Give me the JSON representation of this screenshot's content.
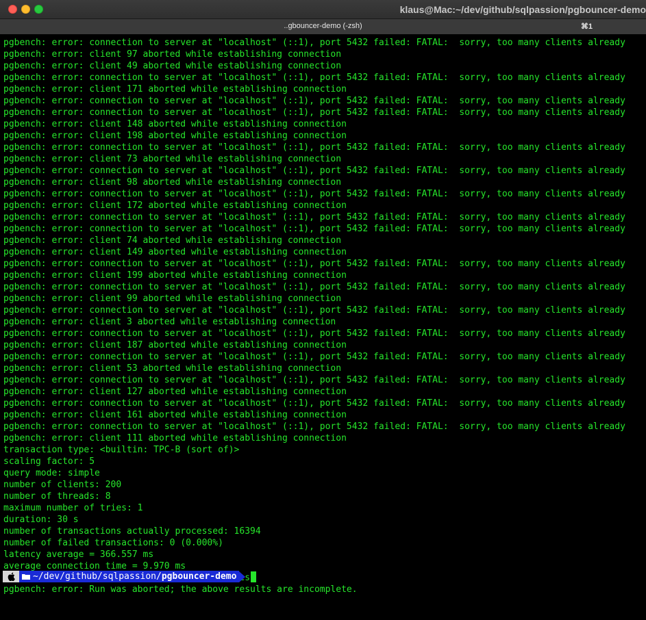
{
  "window": {
    "title": "klaus@Mac:~/dev/github/sqlpassion/pgbouncer-demo",
    "tab_label": "..gbouncer-demo (-zsh)",
    "tab_shortcut": "⌘1"
  },
  "terminal": {
    "lines": [
      "pgbench: error: connection to server at \"localhost\" (::1), port 5432 failed: FATAL:  sorry, too many clients already",
      "pgbench: error: client 97 aborted while establishing connection",
      "pgbench: error: client 49 aborted while establishing connection",
      "pgbench: error: connection to server at \"localhost\" (::1), port 5432 failed: FATAL:  sorry, too many clients already",
      "pgbench: error: client 171 aborted while establishing connection",
      "pgbench: error: connection to server at \"localhost\" (::1), port 5432 failed: FATAL:  sorry, too many clients already",
      "pgbench: error: connection to server at \"localhost\" (::1), port 5432 failed: FATAL:  sorry, too many clients already",
      "pgbench: error: client 148 aborted while establishing connection",
      "pgbench: error: client 198 aborted while establishing connection",
      "pgbench: error: connection to server at \"localhost\" (::1), port 5432 failed: FATAL:  sorry, too many clients already",
      "pgbench: error: client 73 aborted while establishing connection",
      "pgbench: error: connection to server at \"localhost\" (::1), port 5432 failed: FATAL:  sorry, too many clients already",
      "pgbench: error: client 98 aborted while establishing connection",
      "pgbench: error: connection to server at \"localhost\" (::1), port 5432 failed: FATAL:  sorry, too many clients already",
      "pgbench: error: client 172 aborted while establishing connection",
      "pgbench: error: connection to server at \"localhost\" (::1), port 5432 failed: FATAL:  sorry, too many clients already",
      "pgbench: error: connection to server at \"localhost\" (::1), port 5432 failed: FATAL:  sorry, too many clients already",
      "pgbench: error: client 74 aborted while establishing connection",
      "pgbench: error: client 149 aborted while establishing connection",
      "pgbench: error: connection to server at \"localhost\" (::1), port 5432 failed: FATAL:  sorry, too many clients already",
      "pgbench: error: client 199 aborted while establishing connection",
      "pgbench: error: connection to server at \"localhost\" (::1), port 5432 failed: FATAL:  sorry, too many clients already",
      "pgbench: error: client 99 aborted while establishing connection",
      "pgbench: error: connection to server at \"localhost\" (::1), port 5432 failed: FATAL:  sorry, too many clients already",
      "pgbench: error: client 3 aborted while establishing connection",
      "pgbench: error: connection to server at \"localhost\" (::1), port 5432 failed: FATAL:  sorry, too many clients already",
      "pgbench: error: client 187 aborted while establishing connection",
      "pgbench: error: connection to server at \"localhost\" (::1), port 5432 failed: FATAL:  sorry, too many clients already",
      "pgbench: error: client 53 aborted while establishing connection",
      "pgbench: error: connection to server at \"localhost\" (::1), port 5432 failed: FATAL:  sorry, too many clients already",
      "pgbench: error: client 127 aborted while establishing connection",
      "pgbench: error: connection to server at \"localhost\" (::1), port 5432 failed: FATAL:  sorry, too many clients already",
      "pgbench: error: client 161 aborted while establishing connection",
      "pgbench: error: connection to server at \"localhost\" (::1), port 5432 failed: FATAL:  sorry, too many clients already",
      "pgbench: error: client 111 aborted while establishing connection",
      "transaction type: <builtin: TPC-B (sort of)>",
      "scaling factor: 5",
      "query mode: simple",
      "number of clients: 200",
      "number of threads: 8",
      "maximum number of tries: 1",
      "duration: 30 s",
      "number of transactions actually processed: 16394",
      "number of failed transactions: 0 (0.000%)",
      "latency average = 366.557 ms",
      "average connection time = 9.970 ms",
      "tps = 545.618085 (including reconnection times)",
      "pgbench: error: Run was aborted; the above results are incomplete."
    ],
    "prompt": {
      "path_prefix": "~/dev/github/sqlpassion/",
      "path_current": "pgbouncer-demo",
      "os_icon": "apple-icon",
      "folder_icon": "folder-icon"
    }
  },
  "colors": {
    "text": "#26e62b",
    "background": "#000000",
    "prompt_path_bg": "#1a2bd6",
    "close": "#ff5f57",
    "minimize": "#febc2e",
    "maximize": "#28c840"
  }
}
